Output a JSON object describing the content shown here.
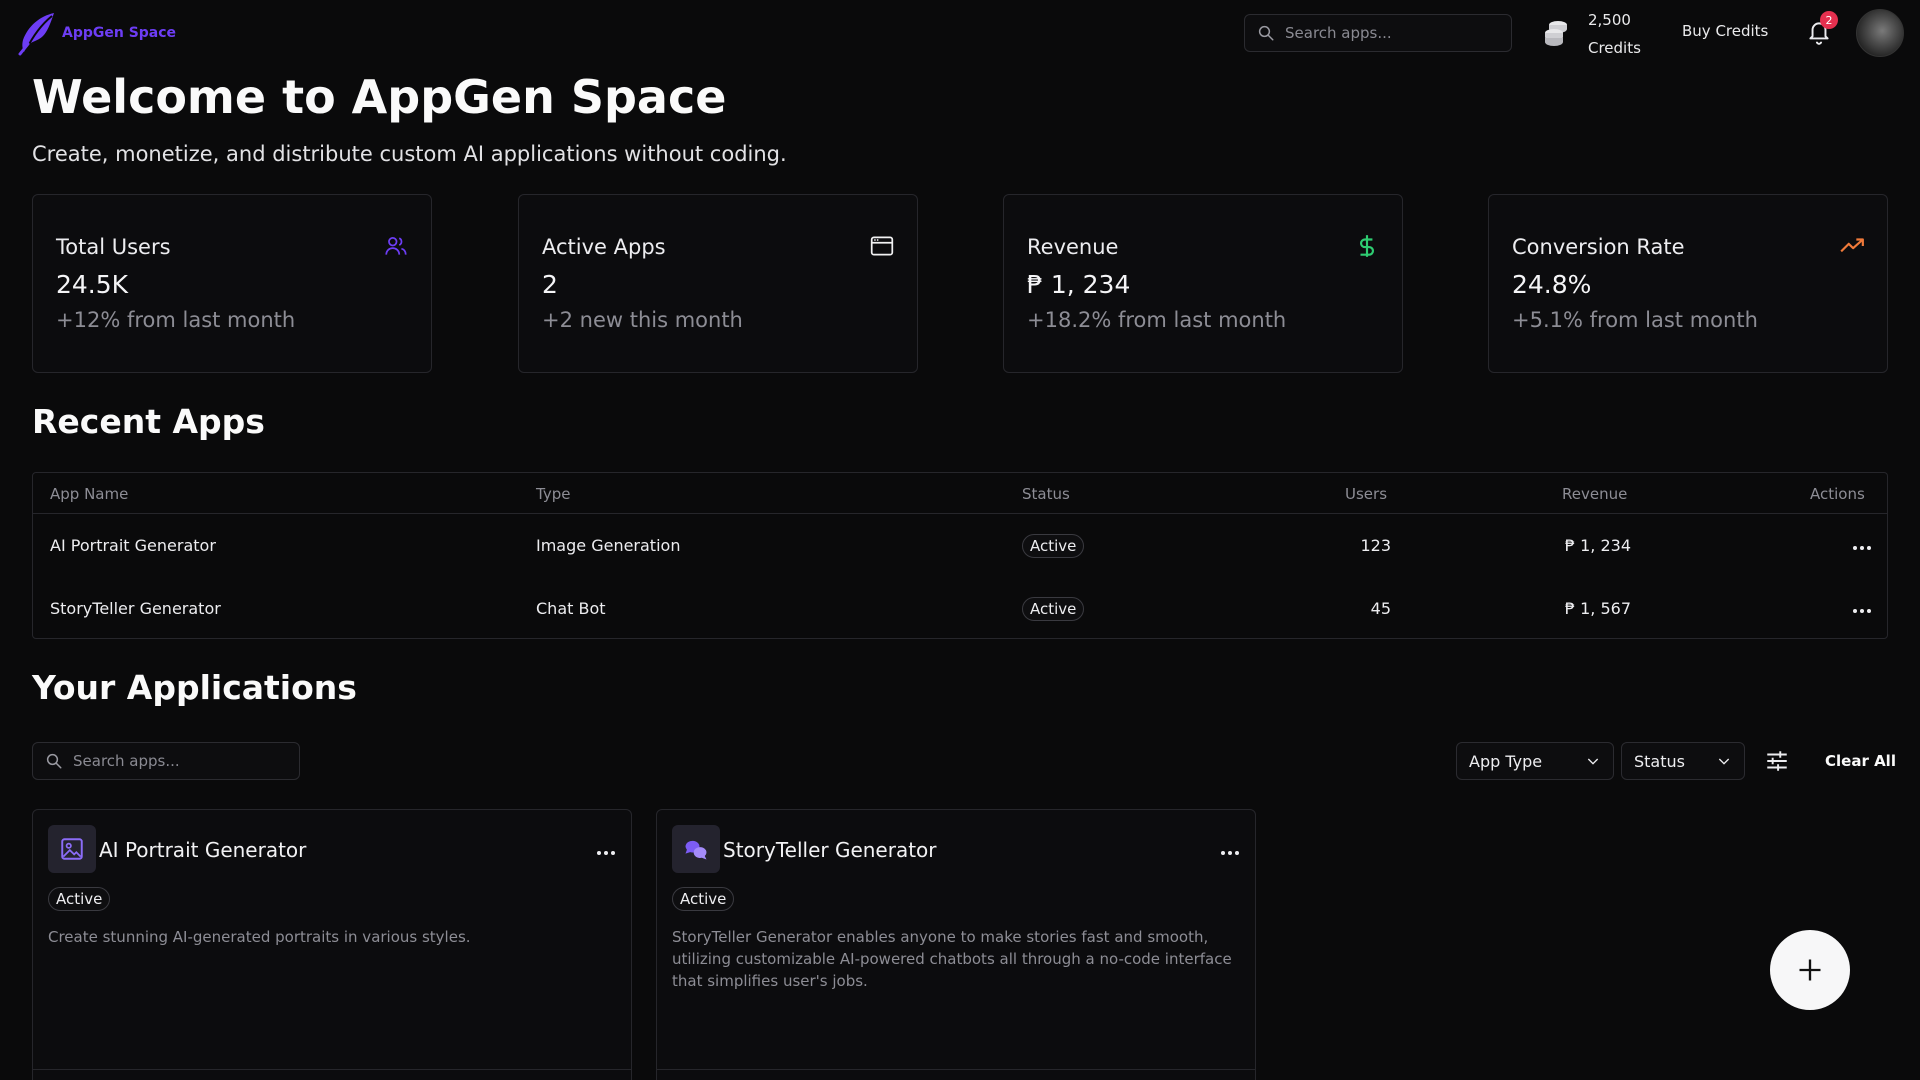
{
  "header": {
    "brand": "AppGen Space",
    "search_placeholder": "Search apps...",
    "credits_amount": "2,500",
    "credits_label": "Credits",
    "buy_credits": "Buy Credits",
    "notification_count": "2"
  },
  "welcome": {
    "title": "Welcome to AppGen Space",
    "subtitle": "Create, monetize, and distribute custom AI applications without coding."
  },
  "stats": [
    {
      "label": "Total Users",
      "value": "24.5K",
      "delta": "+12% from last month",
      "icon": "users-icon",
      "icon_color": "#6d3df5"
    },
    {
      "label": "Active Apps",
      "value": "2",
      "delta": "+2 new this month",
      "icon": "browser-window-icon",
      "icon_color": "#f2f2f3"
    },
    {
      "label": "Revenue",
      "value": "₱ 1, 234",
      "delta": "+18.2% from last month",
      "icon": "dollar-icon",
      "icon_color": "#2ecc71"
    },
    {
      "label": "Conversion Rate",
      "value": "24.8%",
      "delta": "+5.1% from last month",
      "icon": "trending-up-icon",
      "icon_color": "#f07a3a"
    }
  ],
  "recent_apps": {
    "title": "Recent Apps",
    "columns": [
      "App Name",
      "Type",
      "Status",
      "Users",
      "Revenue",
      "Actions"
    ],
    "rows": [
      {
        "name": "AI Portrait Generator",
        "type": "Image Generation",
        "status": "Active",
        "users": "123",
        "revenue": "₱ 1, 234"
      },
      {
        "name": "StoryTeller Generator",
        "type": "Chat Bot",
        "status": "Active",
        "users": "45",
        "revenue": "₱ 1, 567"
      }
    ]
  },
  "applications": {
    "title": "Your Applications",
    "search_placeholder": "Search apps...",
    "filter_app_type": "App Type",
    "filter_status": "Status",
    "clear_all": "Clear All",
    "cards": [
      {
        "name": "AI Portrait Generator",
        "status": "Active",
        "description": "Create stunning AI-generated portraits in various styles.",
        "icon": "image-icon"
      },
      {
        "name": "StoryTeller Generator",
        "status": "Active",
        "description": "StoryTeller Generator enables anyone to make stories fast and smooth, utilizing customizable AI-powered chatbots all through a no-code interface that simplifies user's jobs.",
        "icon": "chat-bubbles-icon"
      }
    ]
  },
  "colors": {
    "background": "#0a0a0b",
    "accent": "#6d3df5",
    "muted_text": "#8d8d95",
    "border": "#26262b"
  }
}
